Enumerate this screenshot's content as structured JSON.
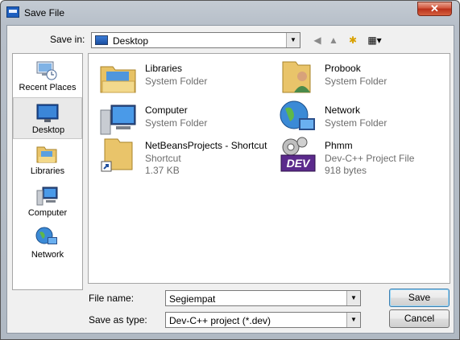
{
  "window": {
    "title": "Save File",
    "close_symbol": "✕"
  },
  "save_in": {
    "label": "Save in:",
    "value": "Desktop"
  },
  "toolbar": {
    "back": "◀",
    "up": "▲",
    "new_folder": "✱",
    "views": "▦▾"
  },
  "places": [
    {
      "label": "Recent Places",
      "icon": "recent-places-icon",
      "selected": false
    },
    {
      "label": "Desktop",
      "icon": "desktop-icon",
      "selected": true
    },
    {
      "label": "Libraries",
      "icon": "libraries-icon",
      "selected": false
    },
    {
      "label": "Computer",
      "icon": "computer-icon",
      "selected": false
    },
    {
      "label": "Network",
      "icon": "network-icon",
      "selected": false
    }
  ],
  "files": [
    {
      "name": "Libraries",
      "type": "System Folder",
      "size": "",
      "icon": "libraries-folder-icon"
    },
    {
      "name": "Probook",
      "type": "System Folder",
      "size": "",
      "icon": "user-folder-icon"
    },
    {
      "name": "Computer",
      "type": "System Folder",
      "size": "",
      "icon": "computer-icon"
    },
    {
      "name": "Network",
      "type": "System Folder",
      "size": "",
      "icon": "network-globe-icon"
    },
    {
      "name": "NetBeansProjects - Shortcut",
      "type": "Shortcut",
      "size": "1.37 KB",
      "icon": "folder-shortcut-icon"
    },
    {
      "name": "Phmm",
      "type": "Dev-C++ Project File",
      "size": "918 bytes",
      "icon": "dev-project-icon",
      "badge": "DEV"
    }
  ],
  "file_name": {
    "label": "File name:",
    "value": "Segiempat"
  },
  "save_as_type": {
    "label": "Save as type:",
    "value": "Dev-C++ project (*.dev)"
  },
  "buttons": {
    "save": "Save",
    "cancel": "Cancel"
  },
  "colors": {
    "accent": "#1e5fbf",
    "close": "#c8432a",
    "dev_badge": "#5b2a8c"
  }
}
